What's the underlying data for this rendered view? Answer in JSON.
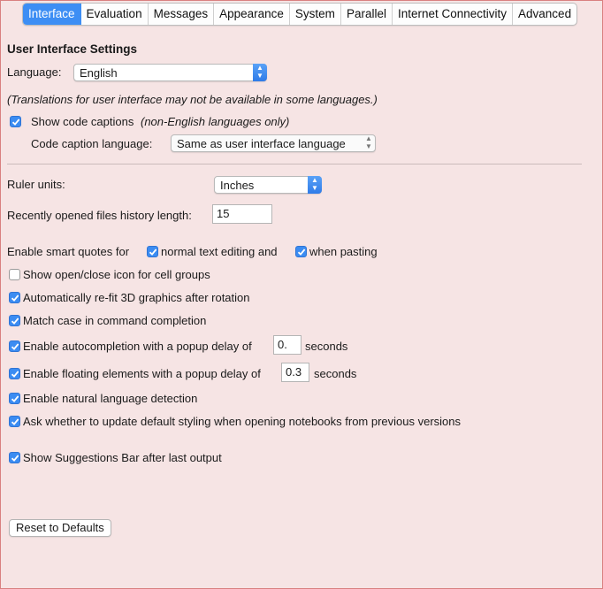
{
  "tabs": [
    "Interface",
    "Evaluation",
    "Messages",
    "Appearance",
    "System",
    "Parallel",
    "Internet Connectivity",
    "Advanced"
  ],
  "active_tab": "Interface",
  "section_title": "User Interface Settings",
  "language": {
    "label": "Language:",
    "value": "English"
  },
  "translation_note": "(Translations for user interface may not be available in some languages.)",
  "code_captions": {
    "checked": true,
    "label": "Show code captions",
    "note": "(non-English languages only)",
    "language_label": "Code caption language:",
    "language_value": "Same as user interface language"
  },
  "ruler": {
    "label": "Ruler units:",
    "value": "Inches"
  },
  "history": {
    "label": "Recently opened files history length:",
    "value": "15"
  },
  "smart_quotes": {
    "label": "Enable smart quotes for",
    "normal_checked": true,
    "normal_label": "normal text editing and",
    "pasting_checked": true,
    "pasting_label": "when pasting"
  },
  "options": {
    "open_close_icon": {
      "checked": false,
      "label": "Show open/close icon for cell groups"
    },
    "refit_3d": {
      "checked": true,
      "label": "Automatically re-fit 3D graphics after rotation"
    },
    "match_case": {
      "checked": true,
      "label": "Match case in command completion"
    },
    "autocompletion": {
      "checked": true,
      "label": "Enable autocompletion with a popup delay of",
      "value": "0.",
      "unit": "seconds"
    },
    "floating": {
      "checked": true,
      "label": "Enable floating elements with a popup delay of",
      "value": "0.3",
      "unit": "seconds"
    },
    "natural_language": {
      "checked": true,
      "label": "Enable natural language detection"
    },
    "update_styling": {
      "checked": true,
      "label": "Ask whether to update default styling when opening notebooks from previous versions"
    },
    "suggestions_bar": {
      "checked": true,
      "label": "Show Suggestions Bar after last output"
    }
  },
  "reset_button": "Reset to Defaults",
  "colors": {
    "accent": "#3d8ef4",
    "background": "#f6e4e4"
  }
}
